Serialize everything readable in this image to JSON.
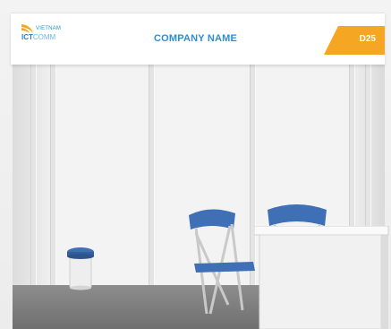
{
  "fascia": {
    "logo": {
      "line1": "VIETNAM",
      "line2_a": "ICT",
      "line2_b": "COMM"
    },
    "company_name": "COMPANY NAME",
    "booth_number": "D25"
  },
  "colors": {
    "brand_blue": "#2b8fd6",
    "badge_orange": "#f5a623",
    "chair_blue": "#3f6fb5",
    "floor_grey": "#7d7d7d"
  }
}
